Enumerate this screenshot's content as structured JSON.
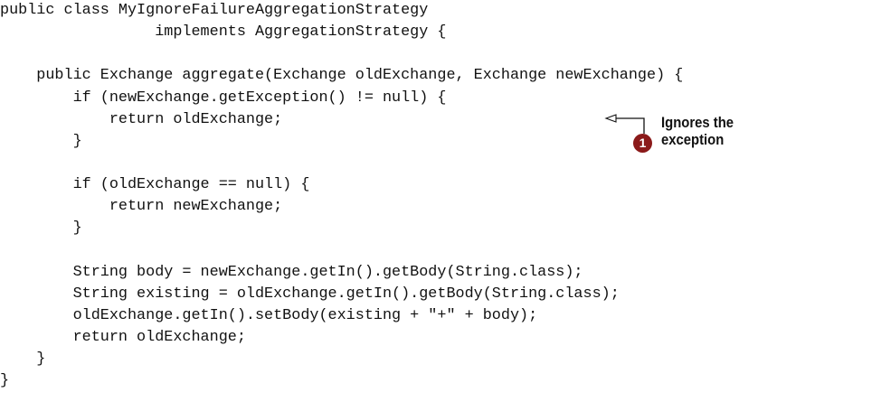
{
  "code": {
    "lines": [
      "public class MyIgnoreFailureAggregationStrategy",
      "                 implements AggregationStrategy {",
      "",
      "    public Exchange aggregate(Exchange oldExchange, Exchange newExchange) {",
      "        if (newExchange.getException() != null) {",
      "            return oldExchange;",
      "        }",
      "",
      "        if (oldExchange == null) {",
      "            return newExchange;",
      "        }",
      "",
      "        String body = newExchange.getIn().getBody(String.class);",
      "        String existing = oldExchange.getIn().getBody(String.class);",
      "        oldExchange.getIn().setBody(existing + \"+\" + body);",
      "        return oldExchange;",
      "    }",
      "}"
    ]
  },
  "callout": {
    "marker": "1",
    "label_line1": "Ignores the",
    "label_line2": "exception"
  },
  "colors": {
    "marker_fill": "#8b1a1a",
    "text": "#111111"
  }
}
